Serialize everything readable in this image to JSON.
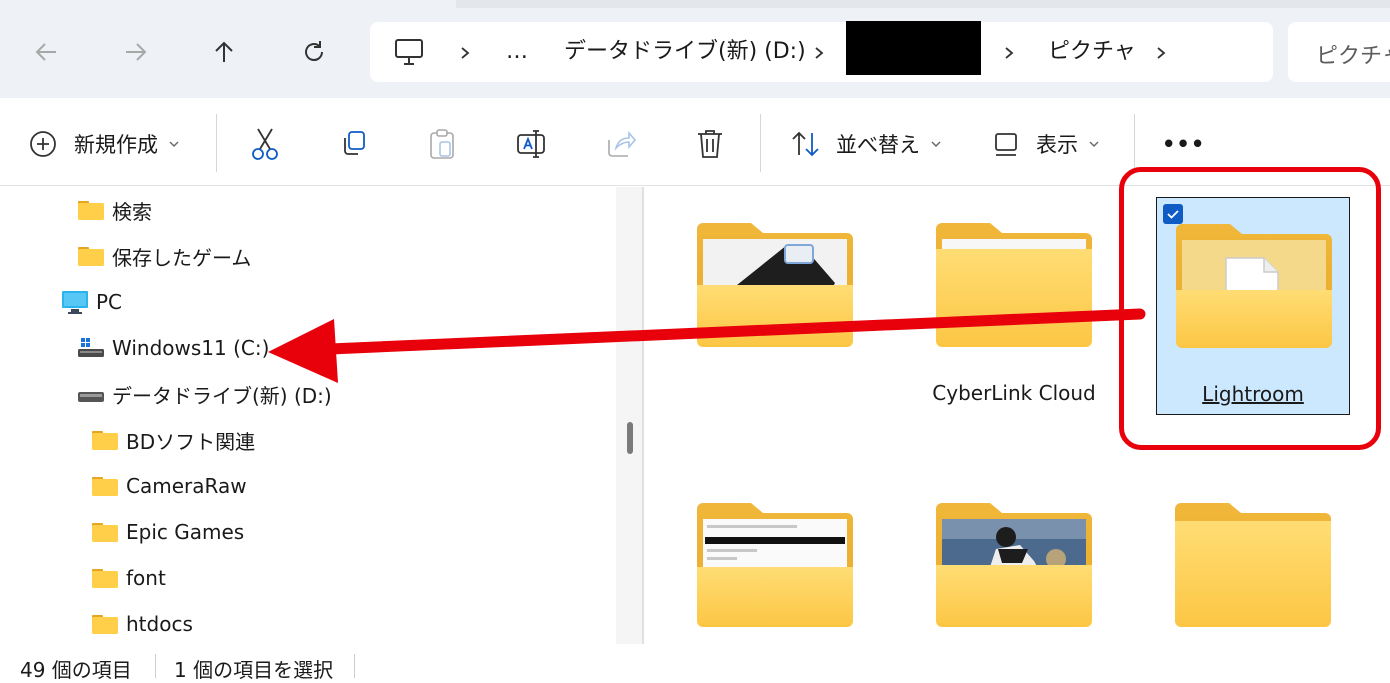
{
  "address_bar": {
    "breadcrumbs": [
      "…",
      "データドライブ(新) (D:)",
      "ピクチャ"
    ],
    "search_placeholder": "ピクチャ"
  },
  "command_bar": {
    "new_label": "新規作成",
    "sort_label": "並べ替え",
    "view_label": "表示",
    "more_label": "•••"
  },
  "nav_pane": {
    "items": [
      {
        "label": "検索",
        "icon": "folder-icon"
      },
      {
        "label": "保存したゲーム",
        "icon": "folder-icon"
      },
      {
        "label": "PC",
        "icon": "pc-icon"
      },
      {
        "label": "Windows11 (C:)",
        "icon": "windows-drive-icon"
      },
      {
        "label": "データドライブ(新) (D:)",
        "icon": "drive-icon"
      },
      {
        "label": "BDソフト関連",
        "icon": "folder-icon"
      },
      {
        "label": "CameraRaw",
        "icon": "folder-icon"
      },
      {
        "label": "Epic Games",
        "icon": "folder-icon"
      },
      {
        "label": "font",
        "icon": "folder-icon"
      },
      {
        "label": "htdocs",
        "icon": "folder-icon"
      }
    ]
  },
  "content": {
    "folders": [
      {
        "label": "",
        "thumbnail": "camera"
      },
      {
        "label": "CyberLink Cloud",
        "thumbnail": "plain"
      },
      {
        "label": "Lightroom",
        "thumbnail": "document",
        "selected": true
      },
      {
        "label": "",
        "thumbnail": "screenshot"
      },
      {
        "label": "",
        "thumbnail": "baseball"
      },
      {
        "label": "",
        "thumbnail": "empty"
      }
    ]
  },
  "status_bar": {
    "item_count": "49 個の項目",
    "selection": "1 個の項目を選択"
  },
  "colors": {
    "accent": "#0f5cc4",
    "selection_bg": "#cce8ff",
    "annotation_red": "#e8000b",
    "folder_yellow": "#ffd358"
  }
}
